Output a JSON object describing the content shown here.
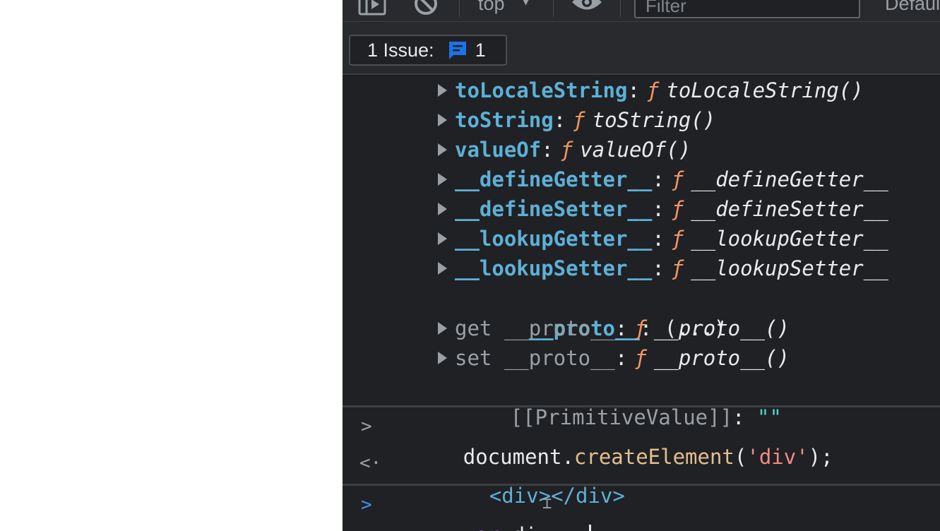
{
  "toolbar": {
    "context": "top",
    "filter_placeholder": "Filter",
    "levels": "Default levels"
  },
  "issues": {
    "label": "1 Issue:",
    "count": "1"
  },
  "console": {
    "proto_entries": [
      {
        "key": "toLocaleString",
        "fn": "toLocaleString()"
      },
      {
        "key": "toString",
        "fn": "toString()"
      },
      {
        "key": "valueOf",
        "fn": "valueOf()"
      },
      {
        "key": "__defineGetter__",
        "fn": "__defineGetter__"
      },
      {
        "key": "__defineSetter__",
        "fn": "__defineSetter__"
      },
      {
        "key": "__lookupGetter__",
        "fn": "__lookupGetter__"
      },
      {
        "key": "__lookupSetter__",
        "fn": "__lookupSetter__"
      }
    ],
    "proto_key": "__proto__",
    "proto_value": "(...)",
    "getter": {
      "key": "get __proto__",
      "fn": "__proto__()"
    },
    "setter": {
      "key": "set __proto__",
      "fn": "__proto__()"
    },
    "primitive_key": "[[PrimitiveValue]]",
    "primitive_value": "\"\"",
    "function_glyph": "ƒ",
    "colon": ":",
    "command": {
      "object": "document.",
      "method": "createElement",
      "open": "(",
      "arg": "'div'",
      "close": ");"
    },
    "result": "<div></div>",
    "input": {
      "keyword": "var",
      "rest": " div = "
    }
  },
  "colors": {
    "background": "#202124",
    "key": "#5db0d7",
    "function": "#f29766",
    "string": "#4cd4c9",
    "prompt_active": "#4d8bf5"
  }
}
